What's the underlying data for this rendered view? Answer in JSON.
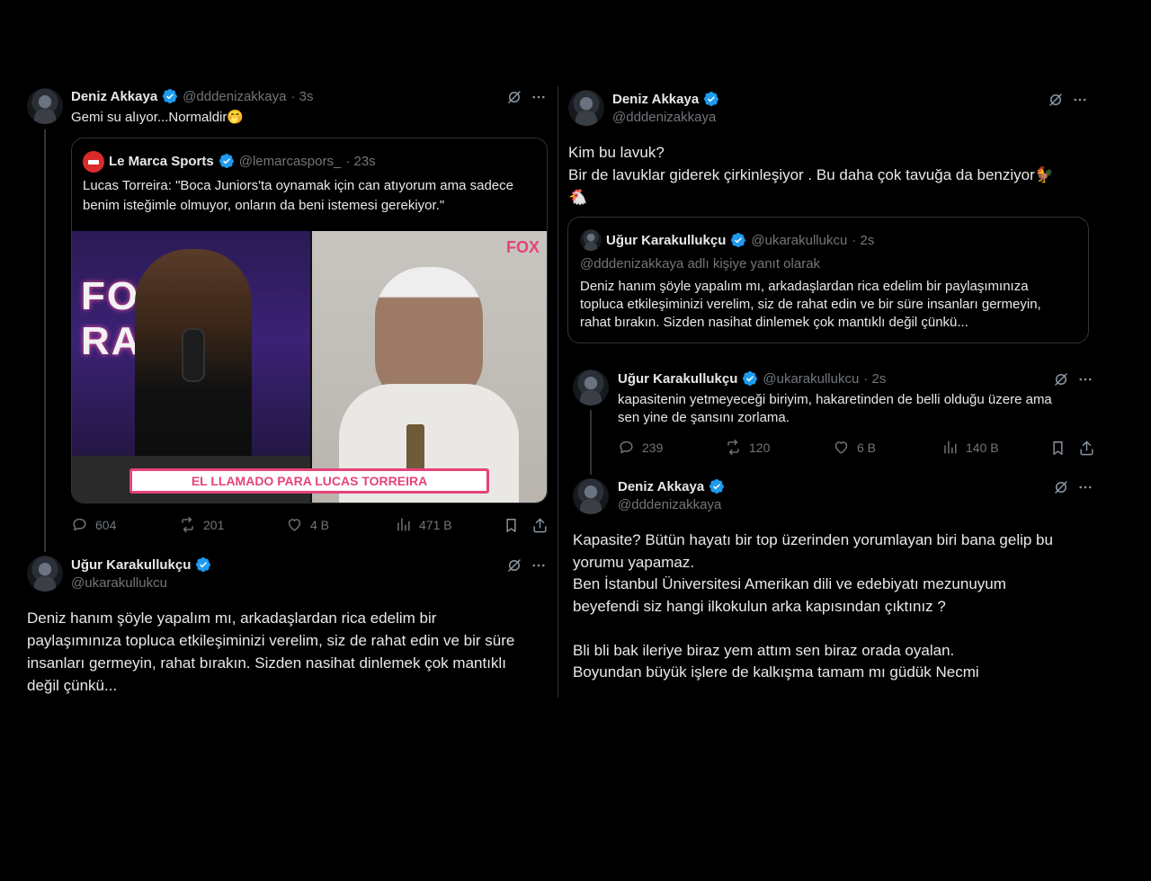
{
  "left": {
    "tweet1": {
      "name": "Deniz Akkaya",
      "handle": "@dddenizakkaya",
      "time": "· 3s",
      "text": "Gemi su alıyor...Normaldir🤭",
      "quote": {
        "name": "Le Marca Sports",
        "handle": "@lemarcaspors_",
        "time": "· 23s",
        "text_line1": "Lucas Torreira: \"Boca Juniors'ta oynamak için can atıyorum ama sadece",
        "text_line2": "benim isteğimle olmuyor, onların da beni istemesi gerekiyor.\"",
        "banner": "EL LLAMADO PARA LUCAS TORREIRA",
        "studio_sign": "FOX RADIO",
        "logo_mark": "FOX"
      },
      "stats": {
        "replies": "604",
        "retweets": "201",
        "likes": "4 B",
        "views": "471 B"
      }
    },
    "tweet2": {
      "name": "Uğur Karakullukçu",
      "handle": "@ukarakullukcu",
      "line1": "Deniz hanım şöyle yapalım mı, arkadaşlardan rica edelim bir",
      "line2": "paylaşımınıza topluca etkileşiminizi verelim, siz de rahat edin ve bir süre",
      "line3": "insanları germeyin, rahat bırakın. Sizden nasihat dinlemek çok mantıklı",
      "line4": "değil çünkü..."
    }
  },
  "right": {
    "tweet1": {
      "name": "Deniz Akkaya",
      "handle": "@dddenizakkaya",
      "line1": "Kim bu lavuk?",
      "line2": "Bir de lavuklar giderek çirkinleşiyor . Bu daha çok tavuğa da benziyor🐓",
      "line3": "🐔",
      "quote": {
        "name": "Uğur Karakullukçu",
        "handle": "@ukarakullukcu",
        "time": "· 2s",
        "reply_to": "@dddenizakkaya adlı kişiye yanıt olarak",
        "line1": "Deniz hanım şöyle yapalım mı, arkadaşlardan rica edelim bir paylaşımınıza",
        "line2": "topluca etkileşiminizi verelim, siz de rahat edin ve bir süre insanları germeyin,",
        "line3": "rahat bırakın. Sizden nasihat dinlemek çok mantıklı değil çünkü..."
      }
    },
    "tweet2": {
      "name": "Uğur Karakullukçu",
      "handle": "@ukarakullukcu",
      "time": "· 2s",
      "line1": "kapasitenin yetmeyeceği biriyim, hakaretinden de belli olduğu üzere ama",
      "line2": "sen yine de şansını zorlama.",
      "stats": {
        "replies": "239",
        "retweets": "120",
        "likes": "6 B",
        "views": "140 B"
      }
    },
    "tweet3": {
      "name": "Deniz Akkaya",
      "handle": "@dddenizakkaya",
      "line1": "Kapasite? Bütün hayatı bir top üzerinden yorumlayan biri bana gelip bu",
      "line2": "yorumu yapamaz.",
      "line3": "Ben İstanbul Üniversitesi Amerikan dili ve edebiyatı mezunuyum",
      "line4": "beyefendi siz hangi ilkokulun arka kapısından çıktınız ?",
      "line5": "Bli bli bak ileriye biraz yem attım sen biraz orada oyalan.",
      "line6": "Boyundan büyük işlere de kalkışma tamam mı güdük Necmi"
    }
  },
  "colors": {
    "verified": "#1d9bf0",
    "banner": "#e6437a",
    "studio_purple": "#4b2a8a"
  }
}
